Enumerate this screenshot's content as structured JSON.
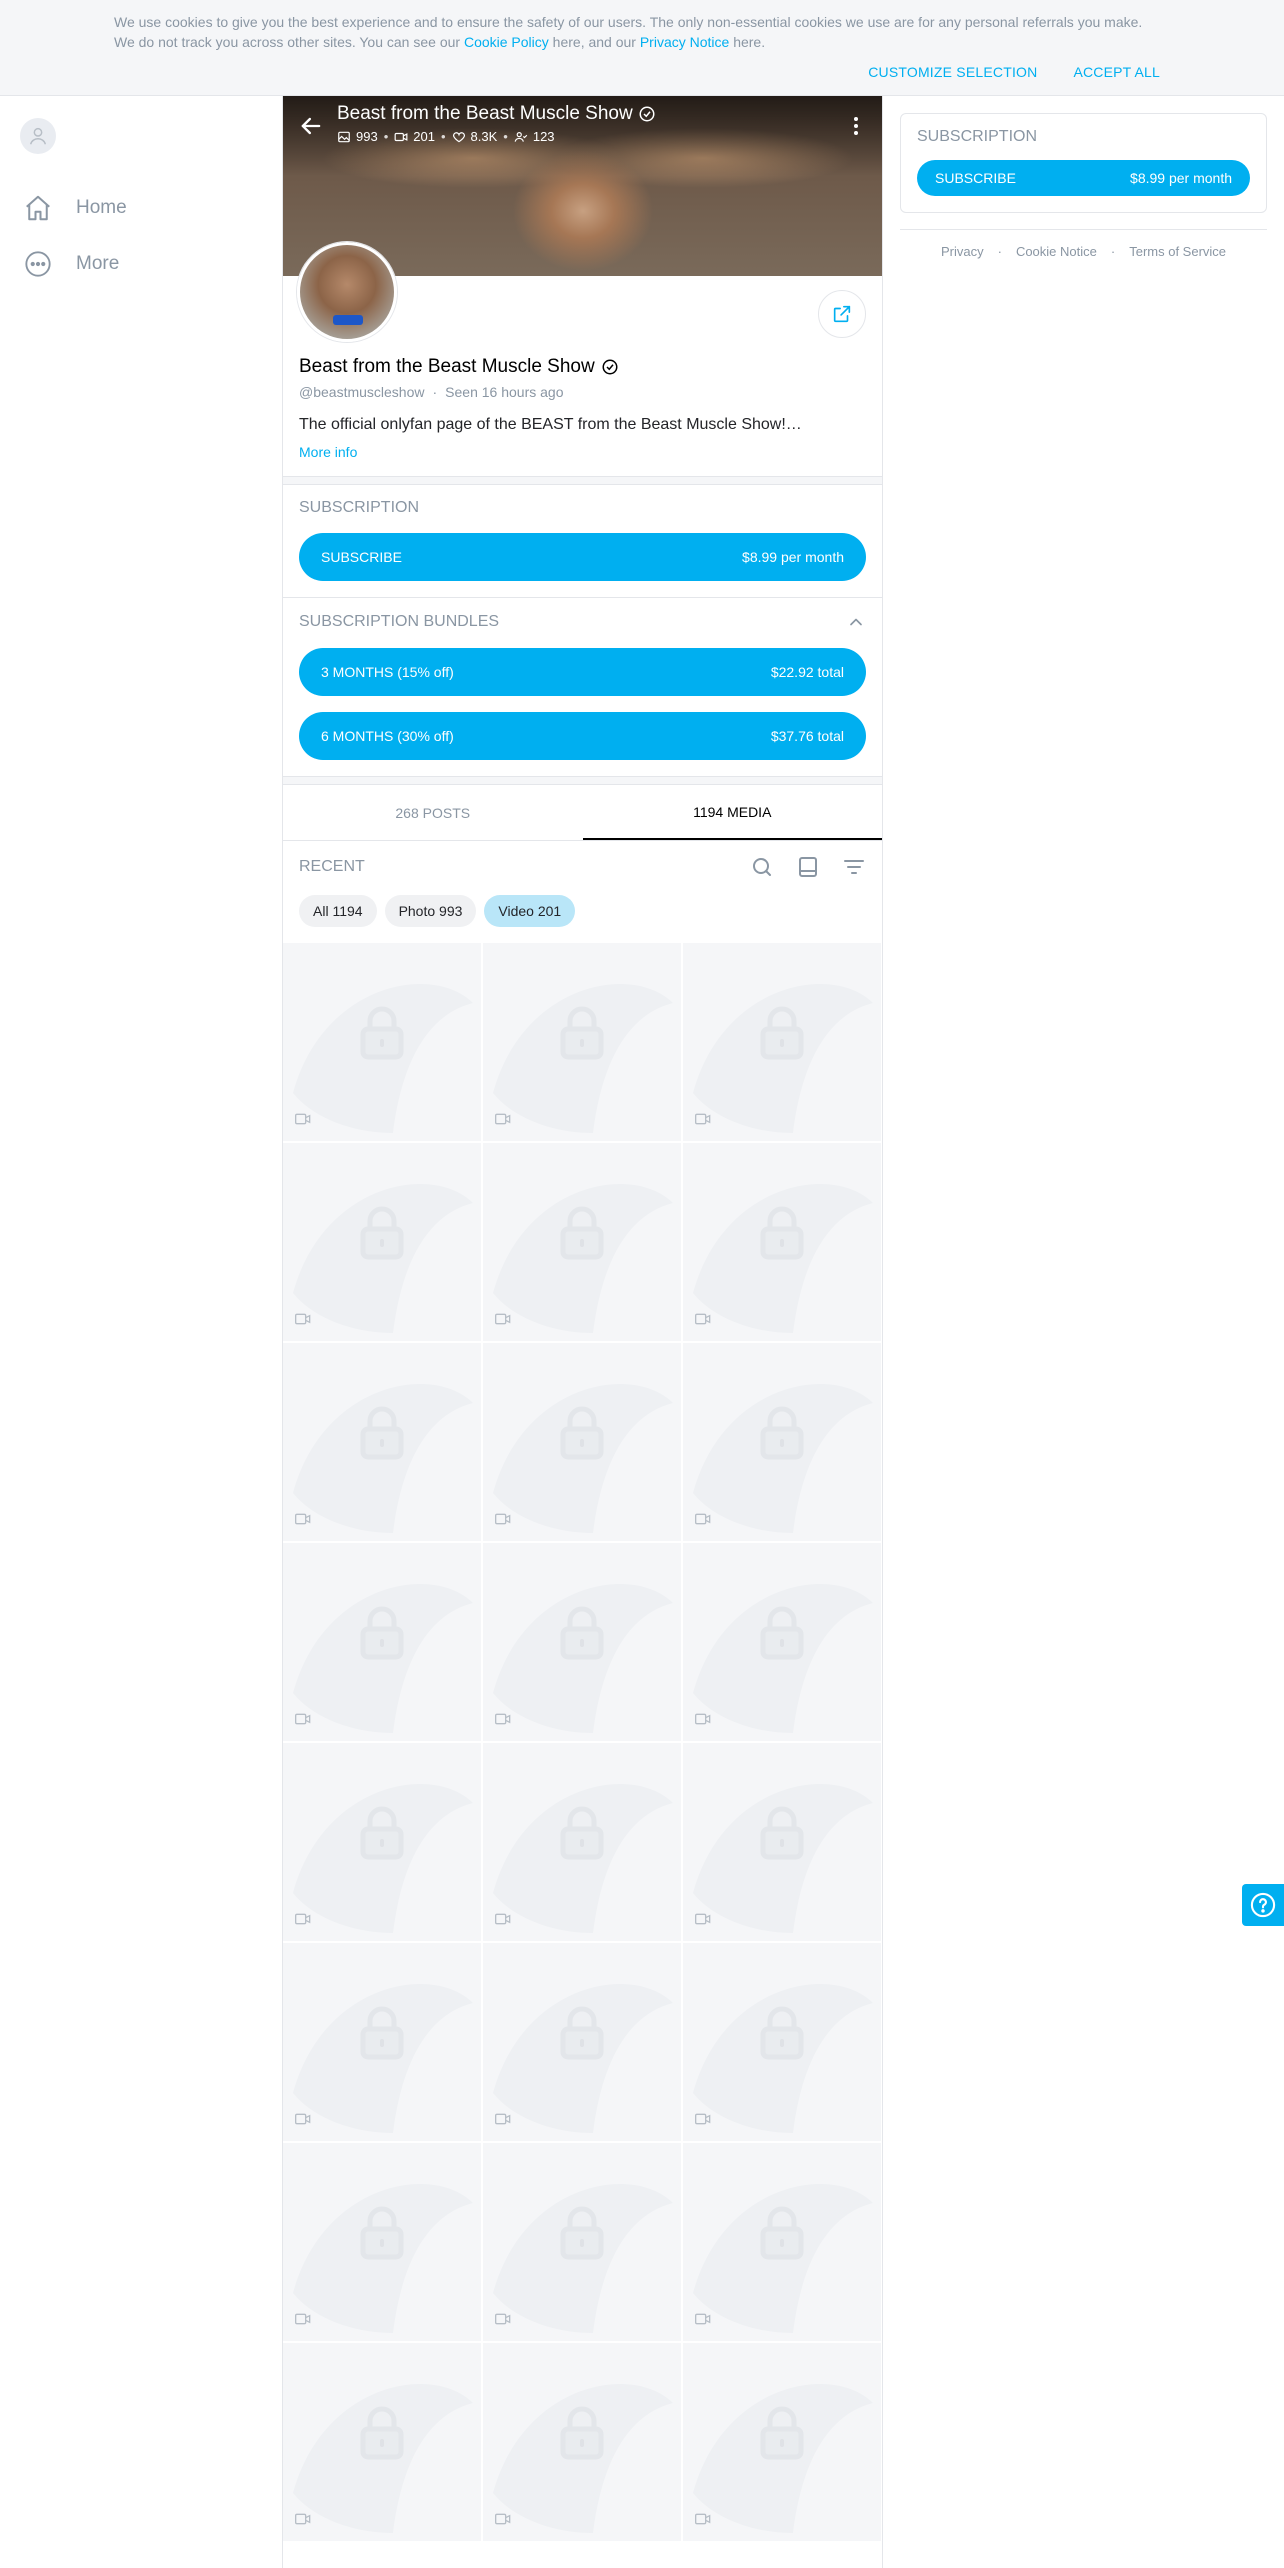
{
  "cookie": {
    "text_before": "We use cookies to give you the best experience and to ensure the safety of our users. The only non-essential cookies we use are for any personal referrals you make. We do not track you across other sites. You can see our ",
    "cookie_policy_link": "Cookie Policy",
    "text_middle": " here, and our ",
    "privacy_link": "Privacy Notice",
    "text_after": " here.",
    "customize_label": "CUSTOMIZE SELECTION",
    "accept_label": "ACCEPT ALL"
  },
  "nav": {
    "items": [
      {
        "label": "Home",
        "icon": "home-icon"
      },
      {
        "label": "More",
        "icon": "more-icon"
      }
    ]
  },
  "profile": {
    "cover_name": "Beast from the Beast Muscle Show",
    "stats": {
      "photos": "993",
      "videos": "201",
      "likes": "8.3K",
      "fans": "123"
    },
    "name": "Beast from the Beast Muscle Show",
    "handle": "@beastmuscleshow",
    "seen": "Seen 16 hours ago",
    "bio": "The official onlyfan page of the BEAST from the Beast Muscle Show!…",
    "more_info": "More info"
  },
  "subscription": {
    "title": "SUBSCRIPTION",
    "button_label": "SUBSCRIBE",
    "price": "$8.99 per month"
  },
  "bundles": {
    "title": "SUBSCRIPTION BUNDLES",
    "items": [
      {
        "label": "3 MONTHS (15% off)",
        "price": "$22.92 total"
      },
      {
        "label": "6 MONTHS (30% off)",
        "price": "$37.76 total"
      }
    ]
  },
  "tabs": [
    {
      "label": "268 POSTS",
      "active": false
    },
    {
      "label": "1194 MEDIA",
      "active": true
    }
  ],
  "media": {
    "title": "RECENT",
    "filters": [
      {
        "label": "All 1194",
        "active": false
      },
      {
        "label": "Photo 993",
        "active": false
      },
      {
        "label": "Video 201",
        "active": true
      }
    ],
    "rows": 8,
    "cols": 3
  },
  "sidebar": {
    "title": "SUBSCRIPTION",
    "button_label": "SUBSCRIBE",
    "price": "$8.99 per month",
    "footer": [
      "Privacy",
      "Cookie Notice",
      "Terms of Service"
    ]
  },
  "colors": {
    "accent": "#00aff0",
    "muted": "#8a96a3",
    "border": "#e4e6ea",
    "tile_bg": "#f5f6f8",
    "chip_active": "#b9e6f8"
  }
}
